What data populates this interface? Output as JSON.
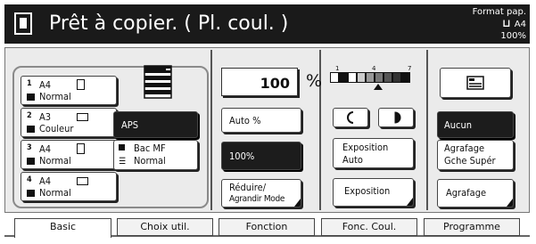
{
  "header": {
    "status_title": "Prêt à copier. ( Pl. coul. )",
    "paper_label": "Format pap.",
    "paper_size": "A4",
    "zoom": "100%"
  },
  "paper": {
    "cassettes": [
      {
        "index": "1",
        "size": "A4",
        "type": "Normal",
        "orientation": "portrait"
      },
      {
        "index": "2",
        "size": "A3",
        "type": "Couleur",
        "orientation": "landscape"
      },
      {
        "index": "3",
        "size": "A4",
        "type": "Normal",
        "orientation": "portrait"
      },
      {
        "index": "4",
        "size": "A4",
        "type": "Normal",
        "orientation": "landscape"
      }
    ],
    "aps_label": "APS",
    "bypass_line1": "Bac  MF",
    "bypass_line2": "Normal"
  },
  "zoom": {
    "value": "100",
    "unit": "%",
    "auto_label": "Auto %",
    "preset_label": "100%",
    "reduce_line1": "Réduire/",
    "reduce_line2": "Agrandir Mode"
  },
  "density": {
    "ticks": [
      "1",
      "4",
      "7"
    ],
    "exposure_auto_line1": "Exposition",
    "exposure_auto_line2": "Auto",
    "exposure_label": "Exposition"
  },
  "finish": {
    "none_label": "Aucun",
    "staple_line1": "Agrafage",
    "staple_line2": "Gche Supér",
    "staple_label": "Agrafage"
  },
  "tabs": [
    {
      "label": "Basic",
      "active": true
    },
    {
      "label": "Choix util.",
      "active": false
    },
    {
      "label": "Fonction",
      "active": false
    },
    {
      "label": "Fonc. Coul.",
      "active": false
    },
    {
      "label": "Programme",
      "active": false
    }
  ]
}
